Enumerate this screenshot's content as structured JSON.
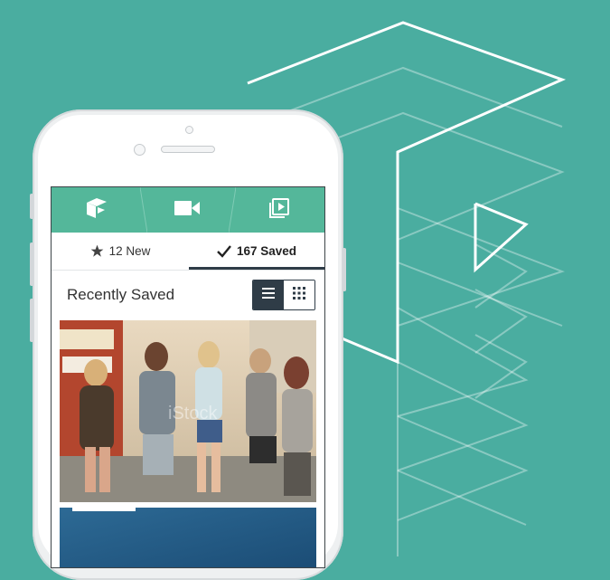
{
  "app": {
    "top_tabs": [
      {
        "icon": "logo-icon"
      },
      {
        "icon": "video-camera-icon"
      },
      {
        "icon": "playlist-icon"
      }
    ],
    "sub_tabs": [
      {
        "icon": "star-icon",
        "label": "12 New",
        "active": false
      },
      {
        "icon": "checkmark-icon",
        "label": "167 Saved",
        "active": true
      }
    ],
    "section": {
      "title": "Recently Saved",
      "view_modes": [
        {
          "icon": "list-view-icon",
          "active": true
        },
        {
          "icon": "grid-view-icon",
          "active": false
        }
      ]
    },
    "photos": [
      {
        "watermark": "iStock"
      },
      {}
    ]
  },
  "colors": {
    "background": "#4aada0",
    "topbar": "#54b79a",
    "accent_dark": "#2f3c47"
  }
}
